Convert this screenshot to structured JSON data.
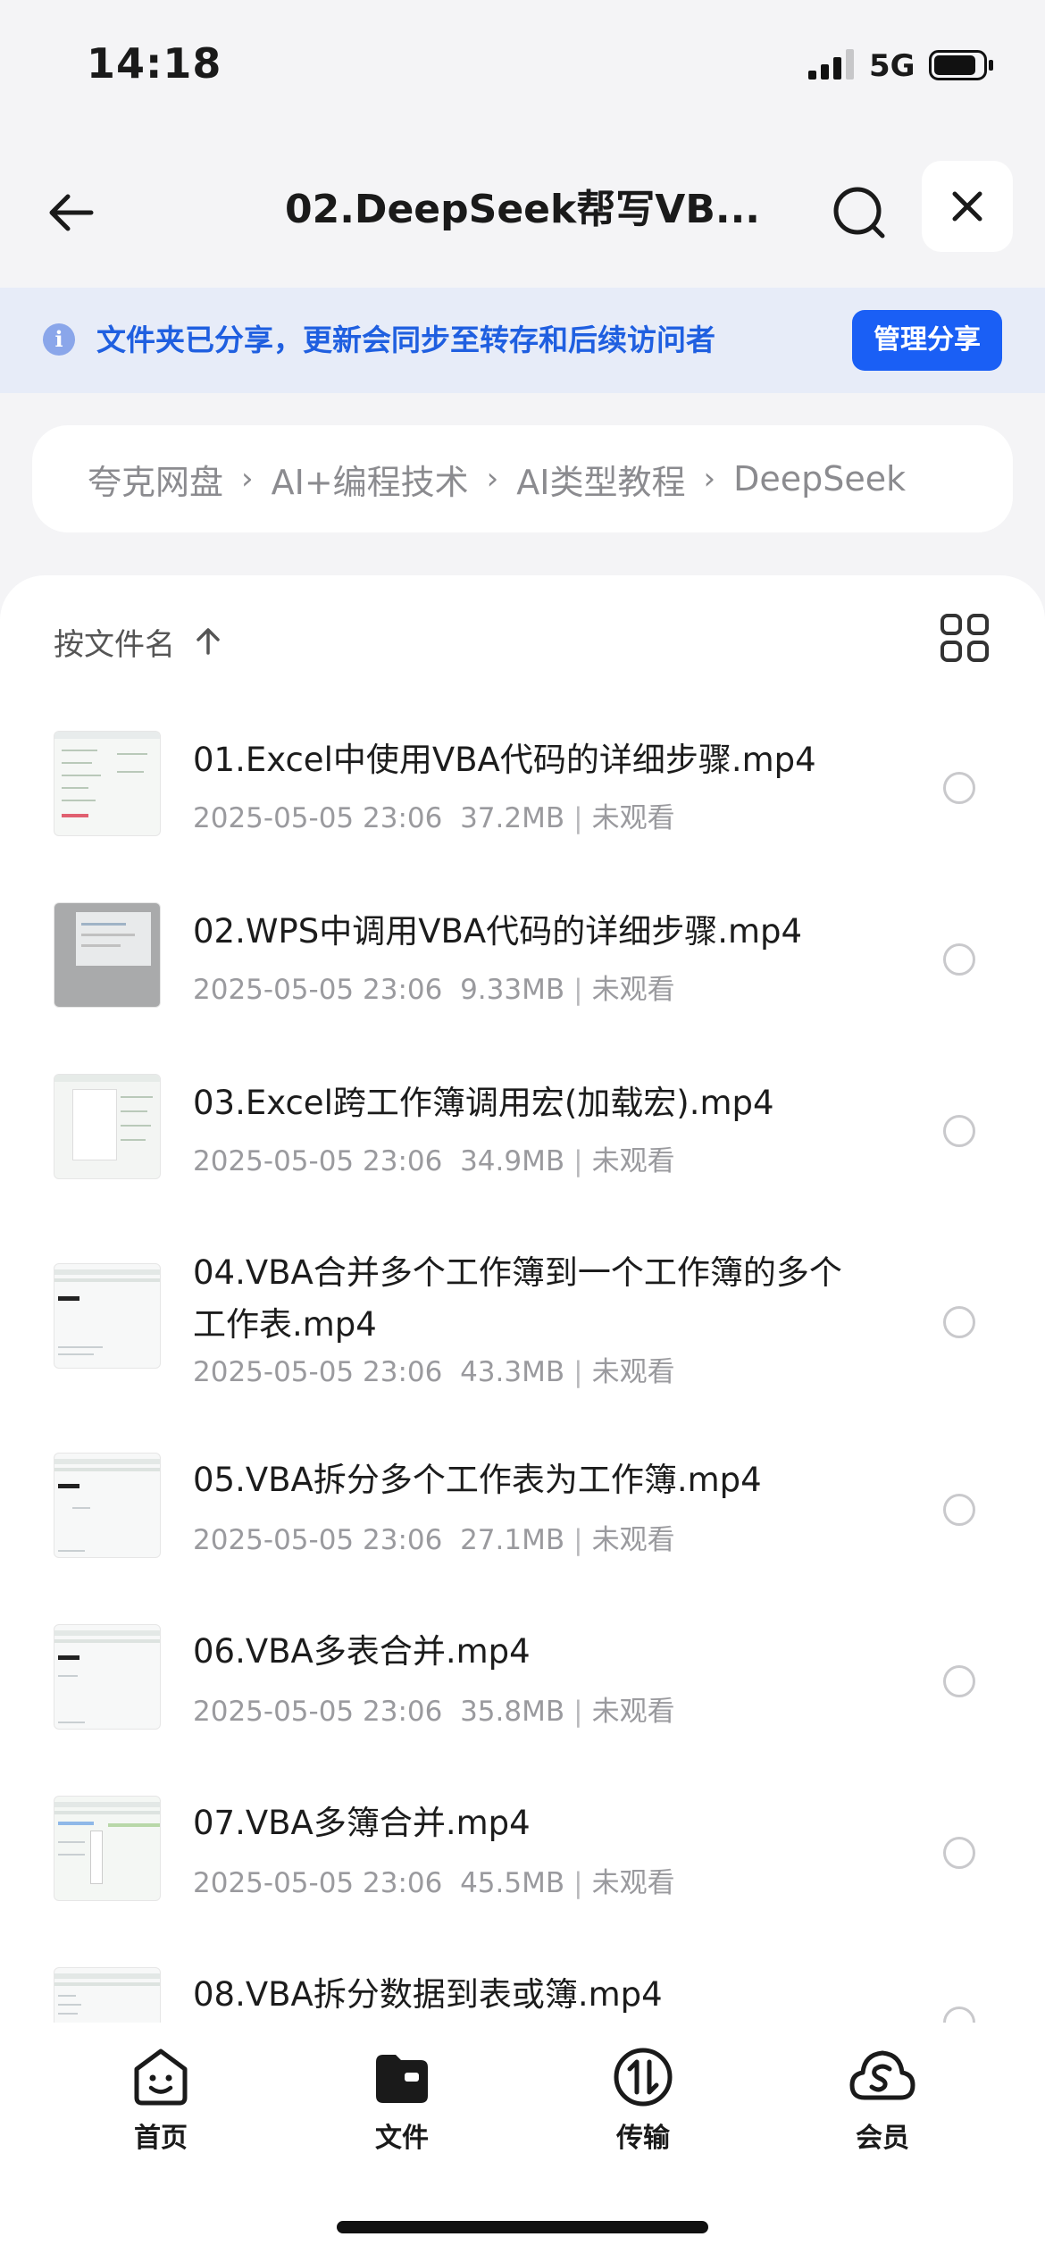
{
  "status_bar": {
    "time": "14:18",
    "network": "5G"
  },
  "nav": {
    "title": "02.DeepSeek帮写VB...",
    "back_icon": "arrow-left-icon",
    "search_icon": "search-icon",
    "close_icon": "close-icon"
  },
  "share_banner": {
    "text": "文件夹已分享，更新会同步至转存和后续访问者",
    "button": "管理分享"
  },
  "breadcrumb": [
    "夸克网盘",
    "AI+编程技术",
    "AI类型教程",
    "DeepSeek"
  ],
  "sort": {
    "label": "按文件名",
    "direction": "ascending"
  },
  "files": [
    {
      "name": "01.Excel中使用VBA代码的详细步骤.mp4",
      "date": "2025-05-05 23:06",
      "size": "37.2MB",
      "status": "未观看"
    },
    {
      "name": "02.WPS中调用VBA代码的详细步骤.mp4",
      "date": "2025-05-05 23:06",
      "size": "9.33MB",
      "status": "未观看"
    },
    {
      "name": "03.Excel跨工作簿调用宏(加载宏).mp4",
      "date": "2025-05-05 23:06",
      "size": "34.9MB",
      "status": "未观看"
    },
    {
      "name": "04.VBA合并多个工作簿到一个工作簿的多个工作表.mp4",
      "date": "2025-05-05 23:06",
      "size": "43.3MB",
      "status": "未观看"
    },
    {
      "name": "05.VBA拆分多个工作表为工作簿.mp4",
      "date": "2025-05-05 23:06",
      "size": "27.1MB",
      "status": "未观看"
    },
    {
      "name": "06.VBA多表合并.mp4",
      "date": "2025-05-05 23:06",
      "size": "35.8MB",
      "status": "未观看"
    },
    {
      "name": "07.VBA多簿合并.mp4",
      "date": "2025-05-05 23:06",
      "size": "45.5MB",
      "status": "未观看"
    },
    {
      "name": "08.VBA拆分数据到表或簿.mp4",
      "date": "",
      "size": "",
      "status": ""
    }
  ],
  "tabs": [
    {
      "label": "首页",
      "icon": "smile-home-icon"
    },
    {
      "label": "文件",
      "icon": "folder-icon"
    },
    {
      "label": "传输",
      "icon": "transfer-icon"
    },
    {
      "label": "会员",
      "icon": "cloud-member-icon"
    }
  ],
  "colors": {
    "accent": "#1a5ff5",
    "banner_bg": "#e7ecf8",
    "banner_text": "#1f5fe0"
  }
}
